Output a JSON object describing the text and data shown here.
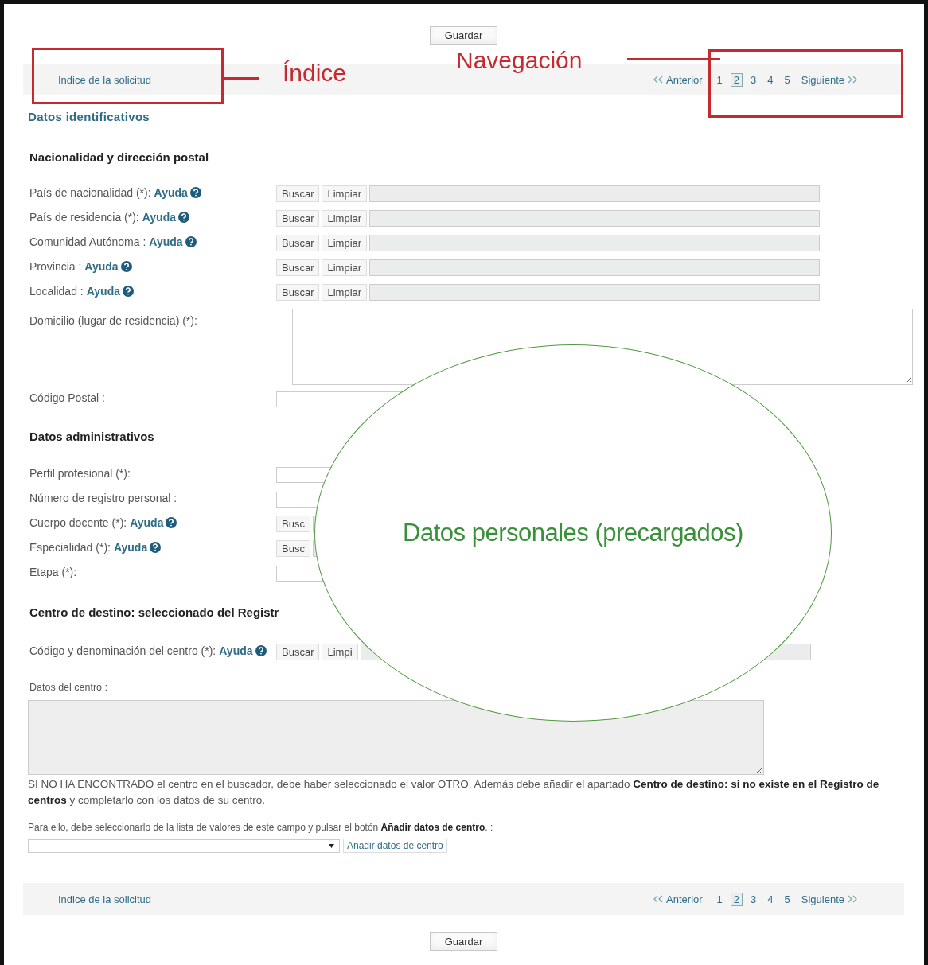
{
  "save_top": "Guardar",
  "nav_top": {
    "index_link": "Indice de la solicitud",
    "previous": "Anterior",
    "next": "Siguiente",
    "pages": [
      {
        "label": "1",
        "selected": false
      },
      {
        "label": "2",
        "selected": true
      },
      {
        "label": "3",
        "selected": false
      },
      {
        "label": "4",
        "selected": false
      },
      {
        "label": "5",
        "selected": false
      }
    ]
  },
  "page_title": "Datos identificativos",
  "sections": [
    {
      "heading": "Nacionalidad y dirección postal",
      "rows": [
        {
          "kind": "lookup",
          "label": "País de nacionalidad (*):",
          "help": "Ayuda",
          "buttons": [
            "Buscar",
            "Limpiar"
          ]
        },
        {
          "kind": "lookup",
          "label": "País de residencia (*):",
          "help": "Ayuda",
          "buttons": [
            "Buscar",
            "Limpiar"
          ]
        },
        {
          "kind": "lookup",
          "label": "Comunidad Autónoma :",
          "help": "Ayuda",
          "buttons": [
            "Buscar",
            "Limpiar"
          ]
        },
        {
          "kind": "lookup",
          "label": "Provincia :",
          "help": "Ayuda",
          "buttons": [
            "Buscar",
            "Limpiar"
          ]
        },
        {
          "kind": "lookup",
          "label": "Localidad :",
          "help": "Ayuda",
          "buttons": [
            "Buscar",
            "Limpiar"
          ]
        },
        {
          "kind": "textarea",
          "label": "Domicilio (lugar de residencia) (*):"
        },
        {
          "kind": "input",
          "label": "Código Postal :"
        }
      ]
    },
    {
      "heading": "Datos administrativos",
      "rows": [
        {
          "kind": "input",
          "label": "Perfil profesional (*):"
        },
        {
          "kind": "input",
          "label": "Número de registro personal :"
        },
        {
          "kind": "lookup",
          "label": "Cuerpo docente (*):",
          "help": "Ayuda",
          "buttons": [
            "Busc"
          ]
        },
        {
          "kind": "lookup",
          "label": "Especialidad (*):",
          "help": "Ayuda",
          "buttons": [
            "Busc"
          ]
        },
        {
          "kind": "input",
          "label": "Etapa (*):"
        }
      ]
    },
    {
      "heading": "Centro de destino: seleccionado del Registr",
      "rows": [
        {
          "kind": "lookup",
          "label": "Código y denominación del centro (*):",
          "help": "Ayuda",
          "buttons": [
            "Buscar",
            "Limpi"
          ]
        }
      ]
    }
  ],
  "center_data": {
    "label": "Datos del centro :"
  },
  "notice": "SI NO HA ENCONTRADO el centro en el buscador, debe haber seleccionado el valor OTRO. Además debe añadir el apartado **Centro de destino: si no existe en el Registro de centros** y completarlo con los datos de su centro.",
  "instruction": "Para ello, debe seleccionarlo de la lista de valores de este campo y pulsar el botón **Añadir datos de centro**. :",
  "add_button": "Añadir datos de centro",
  "nav_bottom": {
    "index_link": "Indice de la solicitud",
    "previous": "Anterior",
    "next": "Siguiente",
    "pages": [
      {
        "label": "1",
        "selected": false
      },
      {
        "label": "2",
        "selected": true
      },
      {
        "label": "3",
        "selected": false
      },
      {
        "label": "4",
        "selected": false
      },
      {
        "label": "5",
        "selected": false
      }
    ]
  },
  "save_bottom": "Guardar",
  "annotations": {
    "index": "Índice",
    "navigation": "Navegación",
    "callout": "Datos personales (precargados)"
  }
}
